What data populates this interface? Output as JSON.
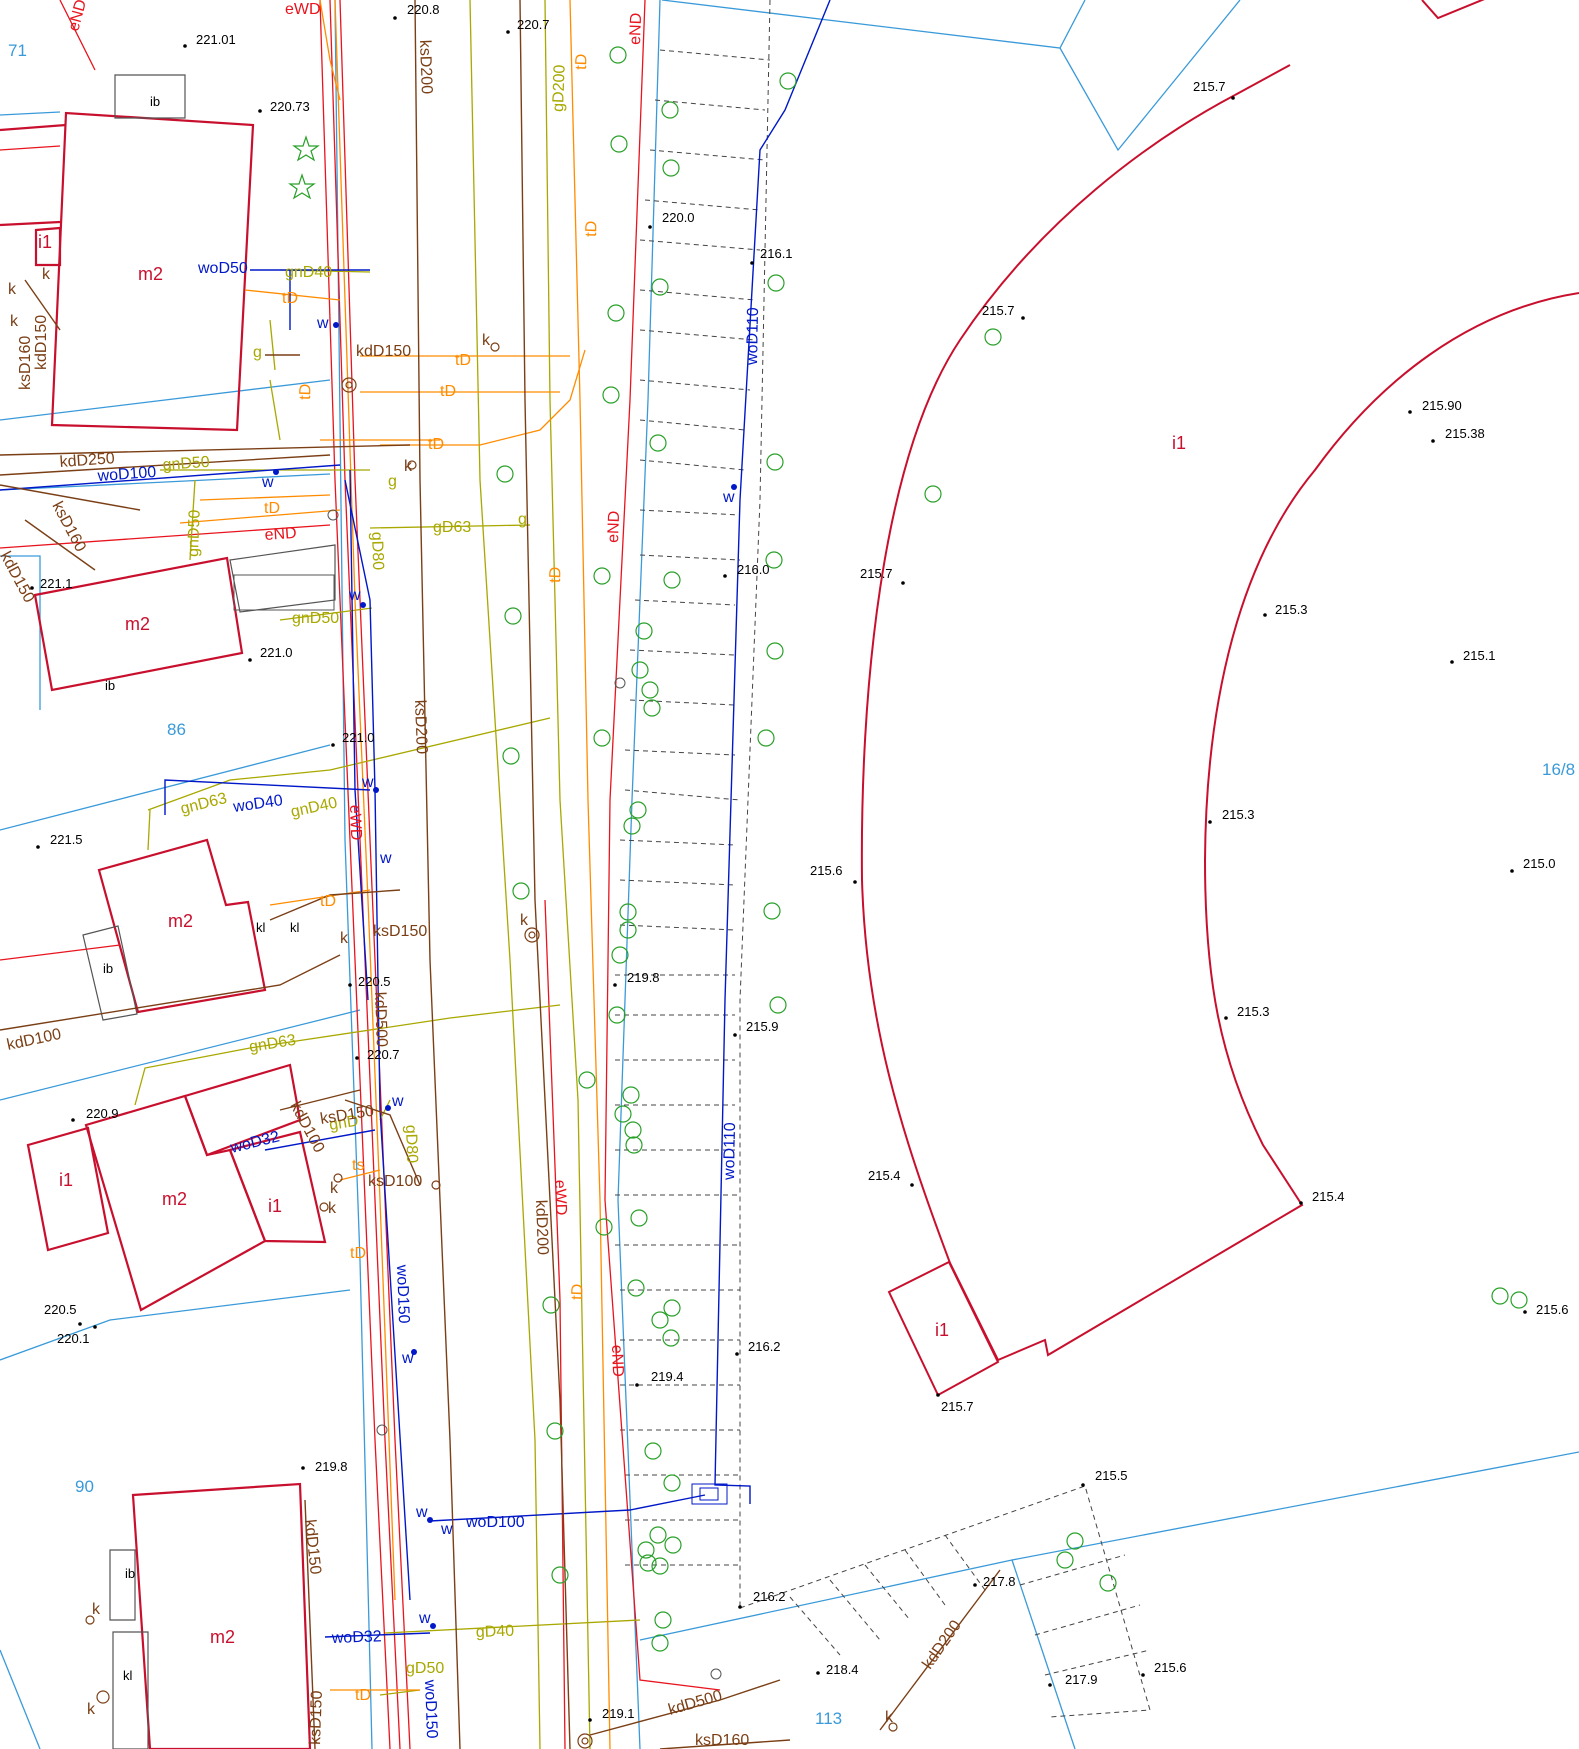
{
  "colors": {
    "boundary": "#3a9ad9",
    "building": "#c8102e",
    "water": "#0018c8",
    "gas": "#a8a800",
    "heat": "#ff8c00",
    "electric": "#e8141e",
    "sewer": "#7b3f16",
    "tree": "#28a028",
    "dashed": "#444444"
  },
  "parcels": [
    "71",
    "86",
    "90",
    "113",
    "16/8"
  ],
  "buildings": [
    "m2",
    "m2",
    "m2",
    "m2",
    "m2",
    "m2",
    "i1",
    "i1",
    "i1",
    "i1",
    "i1",
    "ib",
    "ib",
    "ib",
    "ib",
    "kl",
    "kl",
    "kl"
  ],
  "elevations": [
    "220.8",
    "220.7",
    "221.01",
    "220.73",
    "215.7",
    "220.0",
    "216.1",
    "215.7",
    "215.90",
    "215.38",
    "216.0",
    "215.7",
    "221.1",
    "215.3",
    "215.1",
    "221.0",
    "221.0",
    "221.5",
    "215.3",
    "215.6",
    "215.0",
    "220.5",
    "219.8",
    "215.9",
    "215.3",
    "220.7",
    "220.9",
    "215.4",
    "215.4",
    "220.5",
    "220.1",
    "216.2",
    "219.4",
    "215.6",
    "215.7",
    "219.8",
    "215.5",
    "217.8",
    "216.2",
    "218.4",
    "215.6",
    "217.9",
    "219.1"
  ],
  "utilities": {
    "water": [
      "woD50",
      "woD100",
      "woD40",
      "woD110",
      "woD110",
      "woD32",
      "woD150",
      "woD100",
      "woD32",
      "woD150"
    ],
    "gas": [
      "gnD40",
      "gnD50",
      "gD200",
      "gnD50",
      "gD63",
      "gD80",
      "gnD50",
      "gnD63",
      "gnD40",
      "gnD63",
      "gnD",
      "gD80",
      "gD40",
      "gD50"
    ],
    "heat": [
      "tD",
      "tD",
      "tD",
      "tD",
      "tD",
      "tD",
      "tD",
      "tD",
      "tD",
      "tD",
      "tD",
      "tD",
      "tD",
      "ts"
    ],
    "electric": [
      "eWD",
      "eND",
      "eND",
      "eND",
      "eND",
      "eWD",
      "eWD",
      "eND"
    ],
    "sewer": [
      "ksD200",
      "kdD250",
      "kdD150",
      "ksD160",
      "kdD150",
      "ksD160",
      "kdD150",
      "ksD200",
      "ksD150",
      "kdD500",
      "kdD100",
      "ksD150",
      "kdD100",
      "ksD100",
      "kdD200",
      "kdD150",
      "kdD200",
      "kdD500",
      "ksD160",
      "ksD150"
    ]
  },
  "symbols": {
    "k": "k",
    "w": "w",
    "g": "g",
    "t": "t"
  }
}
